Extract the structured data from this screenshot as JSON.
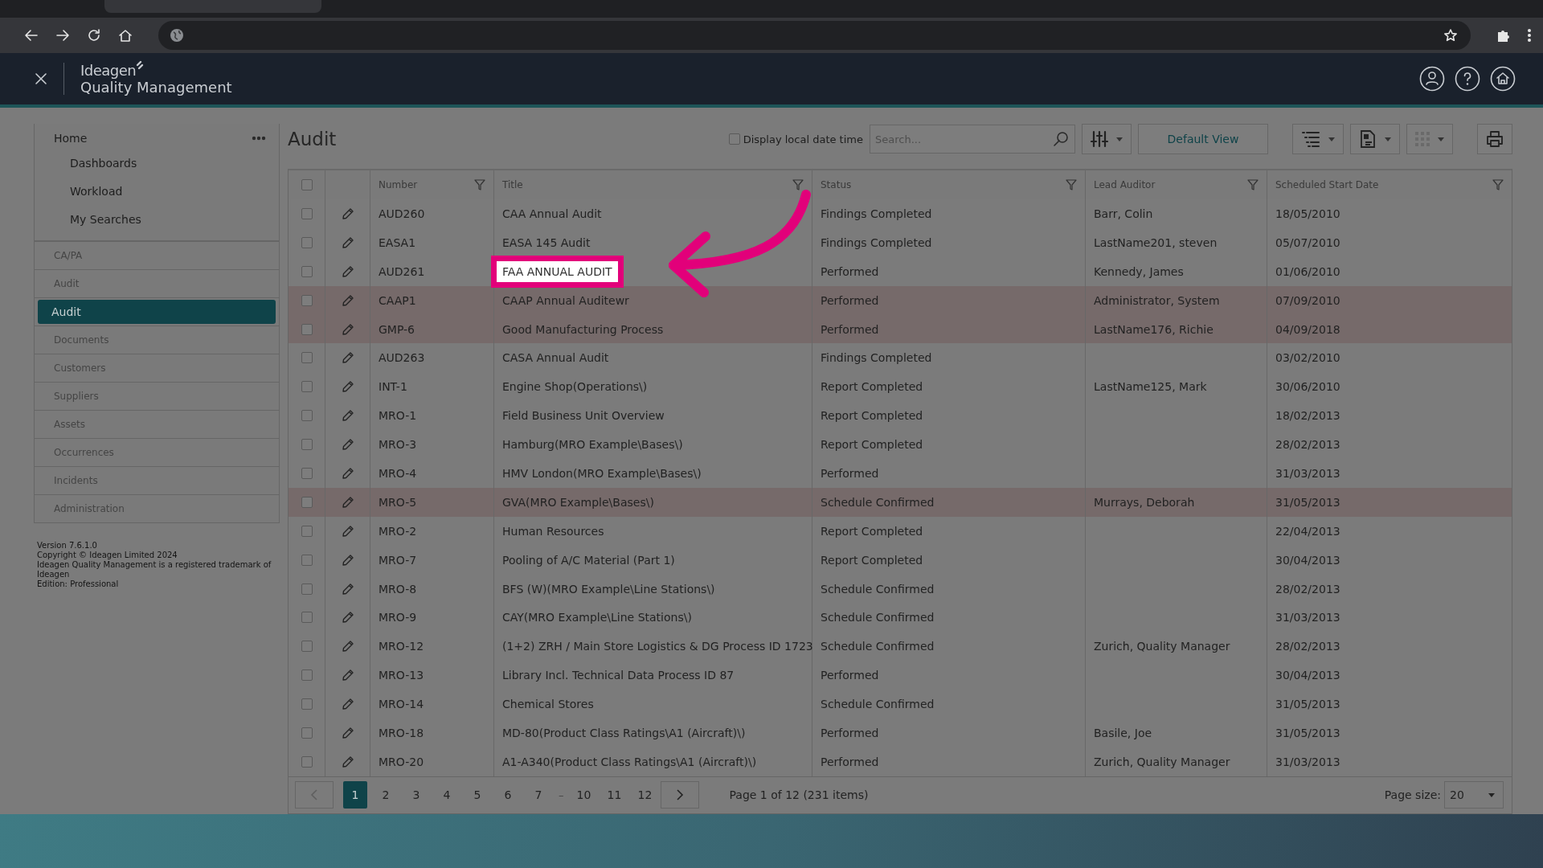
{
  "app": {
    "logo": "Ideagen",
    "product": "Quality Management"
  },
  "sidebar": {
    "home": {
      "label": "Home",
      "children": [
        {
          "label": "Dashboards"
        },
        {
          "label": "Workload"
        },
        {
          "label": "My Searches"
        }
      ]
    },
    "items": [
      {
        "label": "CA/PA",
        "selected": false
      },
      {
        "label": "Audit",
        "selected": false
      },
      {
        "label": "Audit",
        "selected": true
      },
      {
        "label": "Documents",
        "selected": false
      },
      {
        "label": "Customers",
        "selected": false
      },
      {
        "label": "Suppliers",
        "selected": false
      },
      {
        "label": "Assets",
        "selected": false
      },
      {
        "label": "Occurrences",
        "selected": false
      },
      {
        "label": "Incidents",
        "selected": false
      },
      {
        "label": "Administration",
        "selected": false
      }
    ],
    "footer": [
      "Version 7.6.1.0",
      "Copyright © Ideagen Limited 2024",
      "Ideagen Quality Management is a registered trademark of Ideagen",
      "Edition: Professional"
    ]
  },
  "page": {
    "title": "Audit",
    "local_time": {
      "label": "Display local date time",
      "checked": false
    },
    "search": {
      "placeholder": "Search..."
    },
    "view_button": "Default View"
  },
  "table": {
    "select_all": {
      "checked": false
    },
    "columns": [
      "Number",
      "Title",
      "Status",
      "Lead Auditor",
      "Scheduled Start Date"
    ],
    "rows": [
      {
        "checked": false,
        "cells": [
          "AUD260",
          "CAA Annual Audit",
          "Findings Completed",
          "Barr, Colin",
          "18/05/2010"
        ],
        "highlighted": false,
        "spotlight": false
      },
      {
        "checked": false,
        "cells": [
          "EASA1",
          "EASA 145 Audit",
          "Findings Completed",
          "LastName201, steven",
          "05/07/2010"
        ],
        "highlighted": false,
        "spotlight": false
      },
      {
        "checked": false,
        "cells": [
          "AUD261",
          "FAA ANNUAL AUDIT",
          "Performed",
          "Kennedy, James",
          "01/06/2010"
        ],
        "highlighted": false,
        "spotlight": true
      },
      {
        "checked": false,
        "cells": [
          "CAAP1",
          "CAAP Annual Auditewr",
          "Performed",
          "Administrator, System",
          "07/09/2010"
        ],
        "highlighted": true,
        "spotlight": false
      },
      {
        "checked": false,
        "cells": [
          "GMP-6",
          "Good Manufacturing Process",
          "Performed",
          "LastName176, Richie",
          "04/09/2018"
        ],
        "highlighted": true,
        "spotlight": false
      },
      {
        "checked": false,
        "cells": [
          "AUD263",
          "CASA Annual Audit",
          "Findings Completed",
          "",
          "03/02/2010"
        ],
        "highlighted": false,
        "spotlight": false
      },
      {
        "checked": false,
        "cells": [
          "INT-1",
          "Engine Shop(Operations\\)",
          "Report Completed",
          "LastName125, Mark",
          "30/06/2010"
        ],
        "highlighted": false,
        "spotlight": false
      },
      {
        "checked": false,
        "cells": [
          "MRO-1",
          "Field Business Unit Overview",
          "Report Completed",
          "",
          "18/02/2013"
        ],
        "highlighted": false,
        "spotlight": false
      },
      {
        "checked": false,
        "cells": [
          "MRO-3",
          "Hamburg(MRO Example\\Bases\\)",
          "Report Completed",
          "",
          "28/02/2013"
        ],
        "highlighted": false,
        "spotlight": false
      },
      {
        "checked": false,
        "cells": [
          "MRO-4",
          "HMV London(MRO Example\\Bases\\)",
          "Performed",
          "",
          "31/03/2013"
        ],
        "highlighted": false,
        "spotlight": false
      },
      {
        "checked": false,
        "cells": [
          "MRO-5",
          "GVA(MRO Example\\Bases\\)",
          "Schedule Confirmed",
          "Murrays, Deborah",
          "31/05/2013"
        ],
        "highlighted": true,
        "spotlight": false
      },
      {
        "checked": false,
        "cells": [
          "MRO-2",
          "Human Resources",
          "Report Completed",
          "",
          "22/04/2013"
        ],
        "highlighted": false,
        "spotlight": false
      },
      {
        "checked": false,
        "cells": [
          "MRO-7",
          "Pooling of A/C Material (Part 1)",
          "Report Completed",
          "",
          "30/04/2013"
        ],
        "highlighted": false,
        "spotlight": false
      },
      {
        "checked": false,
        "cells": [
          "MRO-8",
          "BFS (W)(MRO Example\\Line Stations\\)",
          "Schedule Confirmed",
          "",
          "28/02/2013"
        ],
        "highlighted": false,
        "spotlight": false
      },
      {
        "checked": false,
        "cells": [
          "MRO-9",
          "CAY(MRO Example\\Line Stations\\)",
          "Schedule Confirmed",
          "",
          "31/03/2013"
        ],
        "highlighted": false,
        "spotlight": false
      },
      {
        "checked": false,
        "cells": [
          "MRO-12",
          "(1+2) ZRH / Main Store Logistics & DG Process ID 1723",
          "Schedule Confirmed",
          "Zurich, Quality Manager",
          "28/02/2013"
        ],
        "highlighted": false,
        "spotlight": false
      },
      {
        "checked": false,
        "cells": [
          "MRO-13",
          "Library Incl. Technical Data Process ID 87",
          "Performed",
          "",
          "30/04/2013"
        ],
        "highlighted": false,
        "spotlight": false
      },
      {
        "checked": false,
        "cells": [
          "MRO-14",
          "Chemical Stores",
          "Schedule Confirmed",
          "",
          "31/05/2013"
        ],
        "highlighted": false,
        "spotlight": false
      },
      {
        "checked": false,
        "cells": [
          "MRO-18",
          "MD-80(Product Class Ratings\\A1 (Aircraft)\\)",
          "Performed",
          "Basile, Joe",
          "31/05/2013"
        ],
        "highlighted": false,
        "spotlight": false
      },
      {
        "checked": false,
        "cells": [
          "MRO-20",
          "A1-A340(Product Class Ratings\\A1 (Aircraft)\\)",
          "Performed",
          "Zurich, Quality Manager",
          "31/03/2013"
        ],
        "highlighted": false,
        "spotlight": false
      }
    ]
  },
  "pagination": {
    "pages": [
      {
        "label": "1",
        "kind": "page",
        "selected": true
      },
      {
        "label": "2",
        "kind": "page",
        "selected": false
      },
      {
        "label": "3",
        "kind": "page",
        "selected": false
      },
      {
        "label": "4",
        "kind": "page",
        "selected": false
      },
      {
        "label": "5",
        "kind": "page",
        "selected": false
      },
      {
        "label": "6",
        "kind": "page",
        "selected": false
      },
      {
        "label": "7",
        "kind": "page",
        "selected": false
      },
      {
        "label": "–",
        "kind": "gap"
      },
      {
        "label": "10",
        "kind": "page",
        "selected": false
      },
      {
        "label": "11",
        "kind": "page",
        "selected": false
      },
      {
        "label": "12",
        "kind": "page",
        "selected": false
      }
    ],
    "summary": "Page 1 of 12 (231 items)",
    "page_size_label": "Page size:",
    "page_size": "20"
  }
}
